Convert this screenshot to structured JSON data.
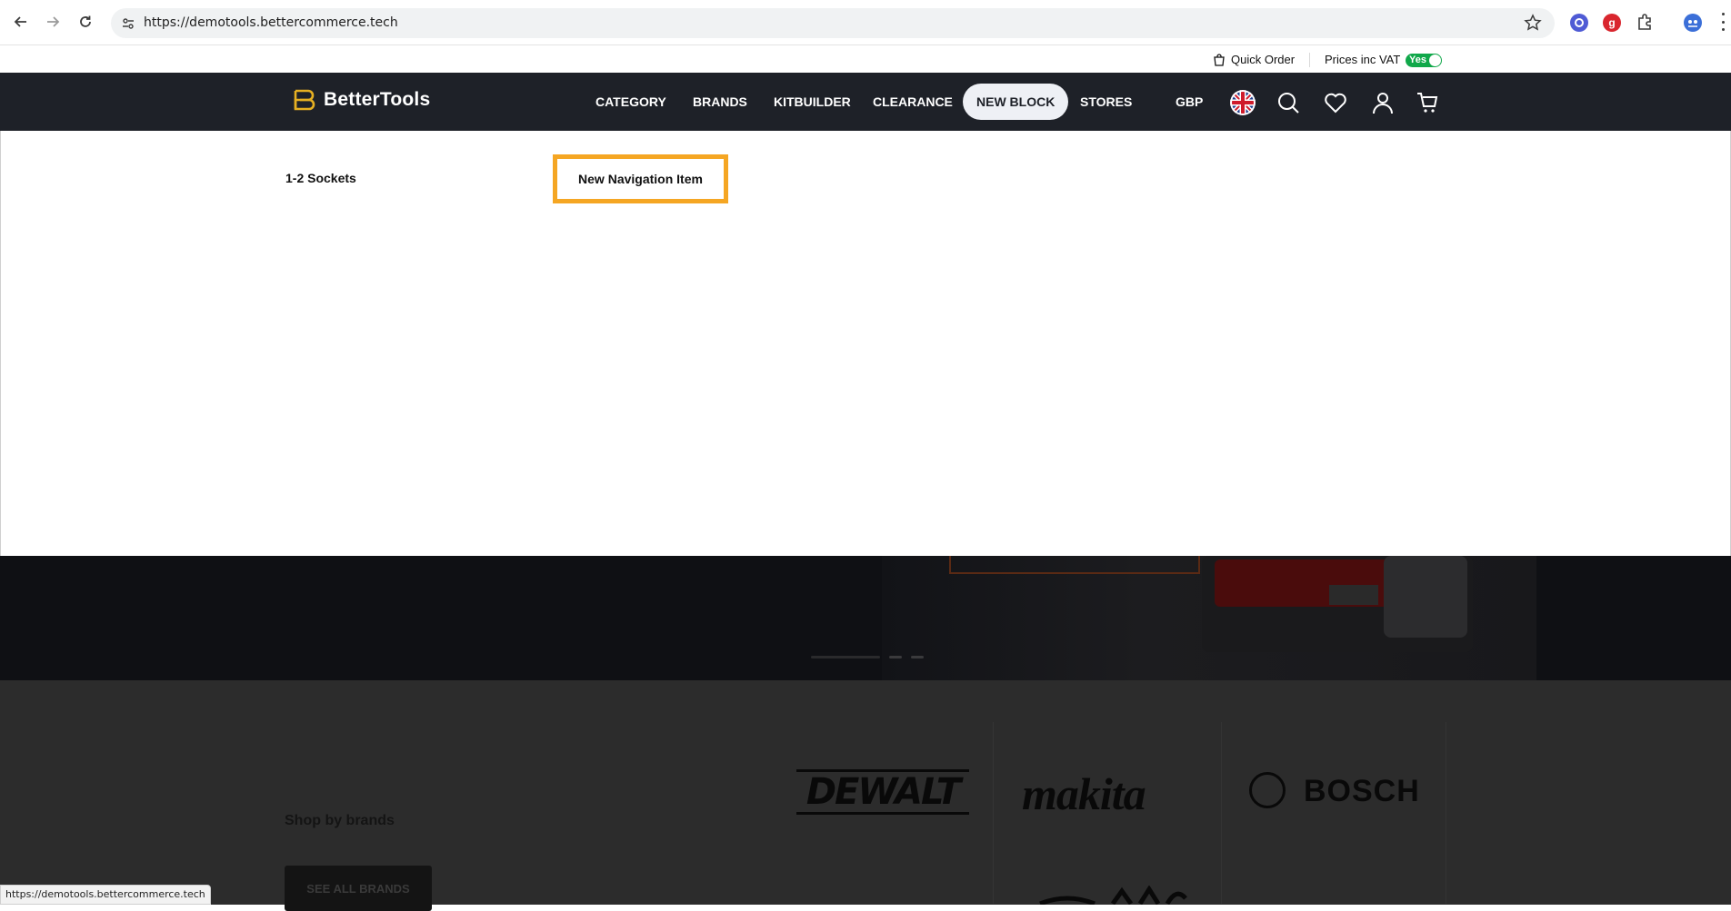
{
  "browser": {
    "url": "https://demotools.bettercommerce.tech",
    "status_url": "https://demotools.bettercommerce.tech",
    "extension_badge": "g"
  },
  "utility_bar": {
    "quick_order": "Quick Order",
    "prices_label": "Prices inc VAT",
    "vat_toggle": "Yes",
    "vat_on": true
  },
  "header": {
    "logo_text": "BetterTools",
    "menu": [
      {
        "label": "CATEGORY"
      },
      {
        "label": "BRANDS"
      },
      {
        "label": "KITBUILDER"
      },
      {
        "label": "CLEARANCE"
      },
      {
        "label": "NEW BLOCK",
        "active": true
      },
      {
        "label": "STORES"
      }
    ],
    "currency": "GBP",
    "icons": [
      "uk-flag-icon",
      "search-icon",
      "heart-icon",
      "user-icon",
      "cart-icon"
    ]
  },
  "dropdown": {
    "items": [
      {
        "label": "1-2 Sockets"
      },
      {
        "label": "New Navigation Item",
        "highlighted": true
      }
    ]
  },
  "page_behind": {
    "brands_title": "Shop by brands",
    "see_all_button": "SEE ALL BRANDS",
    "brand_logos": [
      "DEWALT",
      "makita",
      "BOSCH"
    ]
  },
  "colors": {
    "header_bg": "#1e2128",
    "active_pill": "#eef0f5",
    "highlight_border": "#f5a623",
    "toggle_green": "#10a84a"
  }
}
